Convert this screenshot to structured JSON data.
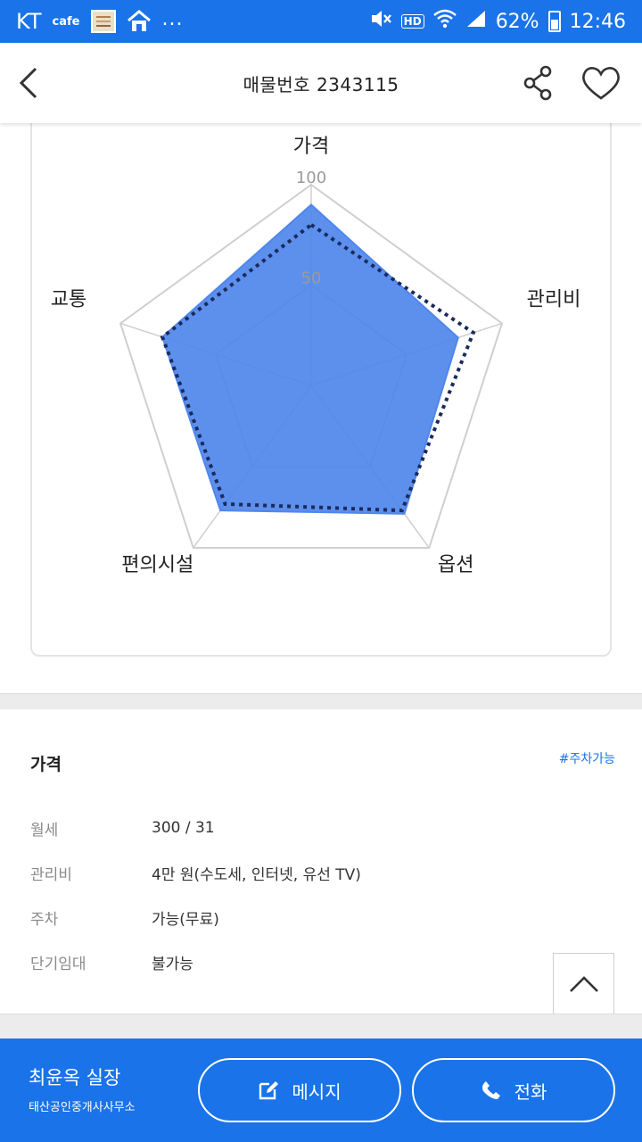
{
  "status_bar": {
    "carrier": "KT",
    "app_label": "cafe",
    "overflow": "...",
    "hd": "HD",
    "battery": "62%",
    "time": "12:46",
    "bg_color": "#1a73e8"
  },
  "header": {
    "title": "매물번호 2343115",
    "back_icon": "chevron-left-icon",
    "share_icon": "share-icon",
    "favorite_icon": "heart-outline-icon"
  },
  "chart_data": {
    "type": "radar",
    "axes": [
      "가격",
      "관리비",
      "옵션",
      "편의시설",
      "교통"
    ],
    "ticks": [
      "100",
      "50"
    ],
    "range": [
      0,
      100
    ],
    "series": [
      {
        "values": [
          90,
          77,
          79,
          77,
          78
        ],
        "style": "filled",
        "color": "#4f86ec"
      },
      {
        "values": [
          80,
          85,
          77,
          73,
          78
        ],
        "style": "dotted",
        "color": "#1a2b5c"
      }
    ]
  },
  "price_section": {
    "title": "가격",
    "tag": "#주차가능",
    "rows": [
      {
        "label": "월세",
        "value": "300 / 31"
      },
      {
        "label": "관리비",
        "value": "4만 원(수도세, 인터넷, 유선 TV)"
      },
      {
        "label": "주차",
        "value": "가능(무료)"
      },
      {
        "label": "단기임대",
        "value": "불가능"
      }
    ]
  },
  "bottom_bar": {
    "agent_name": "최윤옥 실장",
    "agent_office": "태산공인중개사사무소",
    "message_label": "메시지",
    "call_label": "전화",
    "bg_color": "#1a73e8"
  }
}
